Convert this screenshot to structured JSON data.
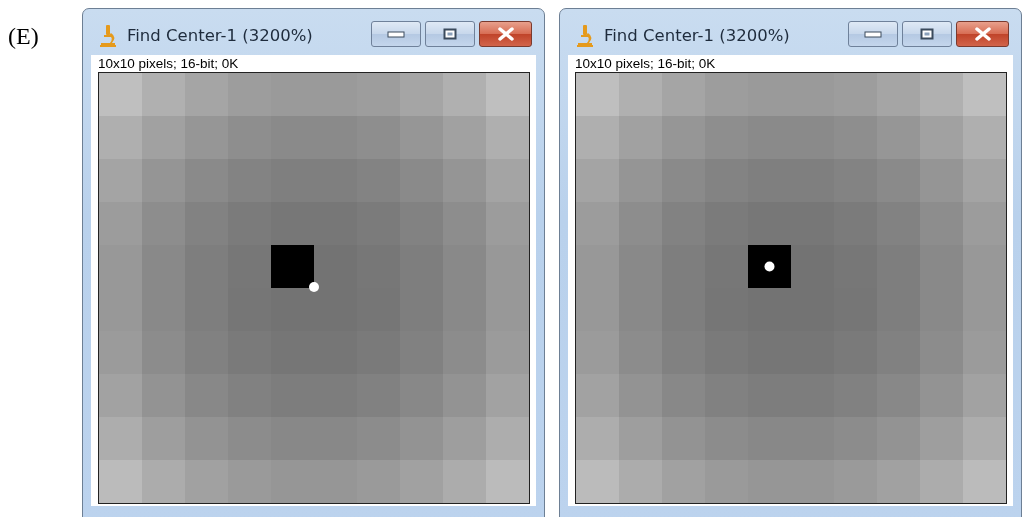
{
  "panel_label": "(E)",
  "windows": [
    {
      "title": "Find Center-1 (3200%)",
      "info": "10x10 pixels; 16-bit; 0K",
      "kind": "corner"
    },
    {
      "title": "Find Center-1 (3200%)",
      "info": "10x10 pixels; 16-bit; 0K",
      "kind": "center"
    }
  ]
}
